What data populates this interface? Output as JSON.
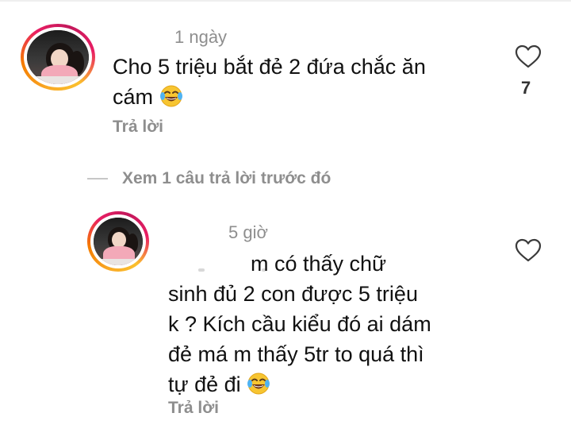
{
  "comments": [
    {
      "time": "1 ngày",
      "text_lines": [
        "Cho 5 triệu bắt đẻ 2 đứa chắc ăn",
        "cám"
      ],
      "emoji": "face-with-tears-of-joy",
      "reply_label": "Trả lời",
      "like_count": "7",
      "icon": "heart-outline-icon"
    },
    {
      "time": "5 giờ",
      "text_lines": [
        "m có thấy chữ",
        "sinh đủ 2 con được 5 triệu",
        "k ? Kích cầu kiểu đó ai dám",
        "đẻ má m thấy 5tr to quá thì",
        "tự đẻ đi"
      ],
      "emoji": "face-with-tears-of-joy",
      "reply_label": "Trả lời",
      "icon": "heart-outline-icon"
    }
  ],
  "view_replies": {
    "label": "Xem 1 câu trả lời trước đó"
  },
  "colors": {
    "text": "#111111",
    "muted": "#8e8e8e",
    "ring_start": "#f9a825",
    "ring_end": "#e91e63"
  }
}
